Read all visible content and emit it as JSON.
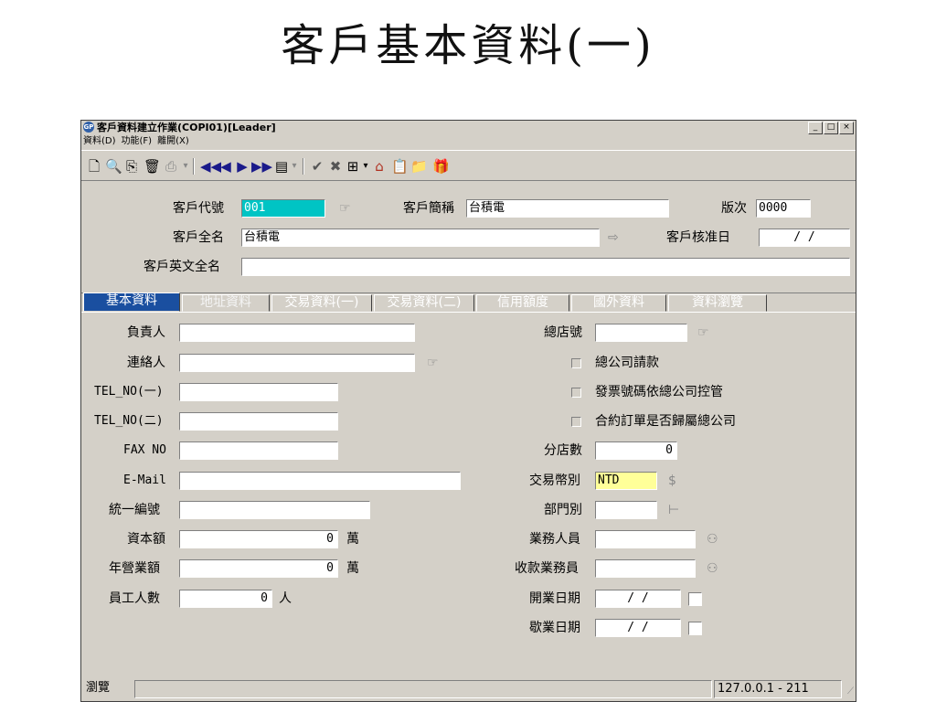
{
  "slide": {
    "title": "客戶基本資料(一)"
  },
  "window": {
    "title": "客戶資料建立作業(COPI01)[Leader]",
    "app_icon": "GP",
    "controls": [
      "_",
      "□",
      "×"
    ]
  },
  "menu": [
    "資料(D)",
    "功能(F)",
    "離開(X)"
  ],
  "toolbar": {
    "icons": [
      "new-doc-icon",
      "preview-icon",
      "copy-icon",
      "delete-icon",
      "print-icon",
      "dropdown-icon",
      "first-icon",
      "prev-icon",
      "next-icon",
      "last-icon",
      "list-icon",
      "dropdown-icon",
      "confirm-icon",
      "cancel-icon",
      "query-icon",
      "dropdown-icon",
      "home-icon",
      "paste-icon",
      "folder-icon",
      "help-icon"
    ]
  },
  "header": {
    "cust_code_label": "客戶代號",
    "cust_code_value": "001",
    "short_name_label": "客戶簡稱",
    "short_name_value": "台積電",
    "version_label": "版次",
    "version_value": "0000",
    "full_name_label": "客戶全名",
    "full_name_value": "台積電",
    "approve_date_label": "客戶核准日",
    "approve_date_value": "/ /",
    "eng_name_label": "客戶英文全名",
    "eng_name_value": ""
  },
  "tabs": [
    "基本資料",
    "地址資料",
    "交易資料(一)",
    "交易資料(二)",
    "信用額度",
    "國外資料",
    "資料瀏覽"
  ],
  "left": {
    "owner": "負責人",
    "contact": "連絡人",
    "tel1": "TEL_NO(一)",
    "tel2": "TEL_NO(二)",
    "fax": "FAX NO",
    "email": "E-Mail",
    "taxid": "統一編號",
    "capital": "資本額",
    "capital_value": "0",
    "capital_unit": "萬",
    "revenue": "年營業額",
    "revenue_value": "0",
    "revenue_unit": "萬",
    "employees": "員工人數",
    "employees_value": "0",
    "employees_unit": "人"
  },
  "right": {
    "hq_code": "總店號",
    "hq_billing": "總公司請款",
    "hq_invoice": "發票號碼依總公司控管",
    "hq_contract": "合約訂單是否歸屬總公司",
    "branches": "分店數",
    "branches_value": "0",
    "currency": "交易幣別",
    "currency_value": "NTD",
    "dept": "部門別",
    "sales": "業務人員",
    "collector": "收款業務員",
    "open_date": "開業日期",
    "open_date_value": "/ /",
    "close_date": "歇業日期",
    "close_date_value": "/ /"
  },
  "status": {
    "mode": "瀏覽",
    "host": "127.0.0.1 - 211"
  },
  "colors": {
    "accent_tab": "#1a4fa0",
    "code_field": "#00c4c4",
    "currency_field": "#ffff99",
    "window_bg": "#d4d0c8"
  }
}
